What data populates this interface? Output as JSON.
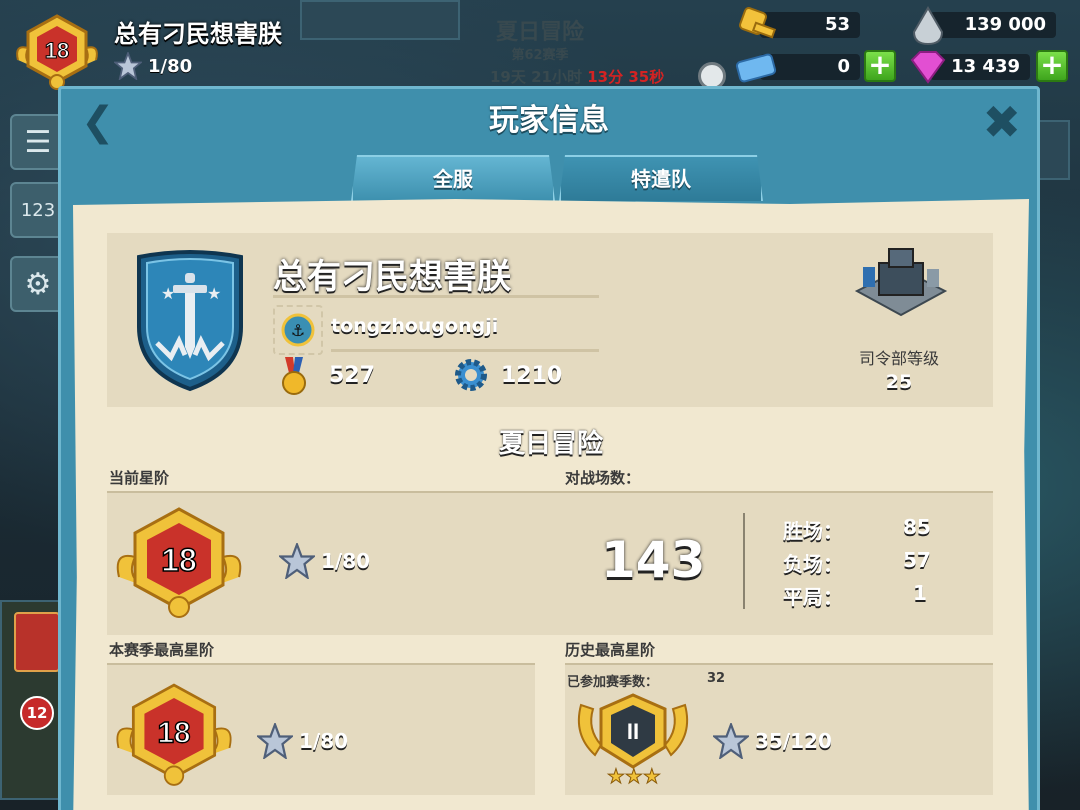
{
  "hud": {
    "rank": "18",
    "player_name": "总有刁民想害朕",
    "stars": "1/80",
    "event_title": "夏日冒险",
    "season": "第62赛季",
    "time_grey": "19天 21小时",
    "time_red": "13分 35秒",
    "keys": "53",
    "blue_tickets": "0",
    "iron": "139 000",
    "gems": "13 439"
  },
  "panel": {
    "title": "玩家信息",
    "tabs": [
      {
        "label": "全服"
      },
      {
        "label": "特遣队"
      }
    ]
  },
  "profile": {
    "name": "总有刁民想害朕",
    "alliance": "tongzhougongji",
    "medals": "527",
    "gear_value": "1210",
    "hq_label": "司令部等级",
    "hq_level": "25"
  },
  "event": {
    "title": "夏日冒险",
    "current_rank_label": "当前星阶",
    "current_rank": "18",
    "current_stars": "1/80",
    "battles_label": "对战场数：",
    "battles_total": "143",
    "wins_label": "胜场：",
    "wins": "85",
    "losses_label": "负场：",
    "losses": "57",
    "draws_label": "平局：",
    "draws": "1",
    "season_best_label": "本赛季最高星阶",
    "season_best_rank": "18",
    "season_best_stars": "1/80",
    "history_best_label": "历史最高星阶",
    "seasons_played_label": "已参加赛季数：",
    "seasons_played": "32",
    "history_badge": "II",
    "history_stars": "35/120"
  },
  "side": {
    "badge_count": "12"
  }
}
